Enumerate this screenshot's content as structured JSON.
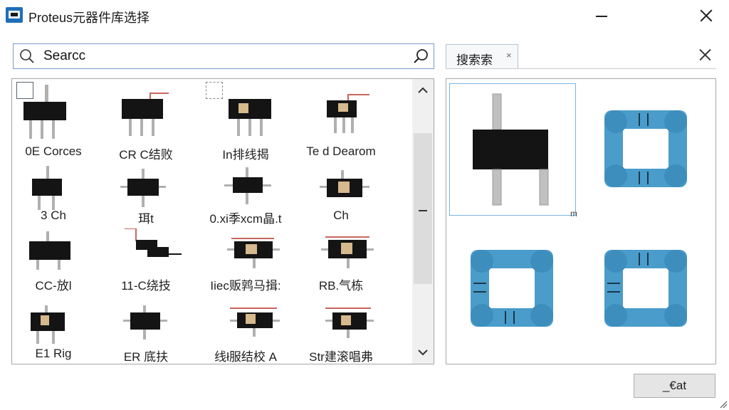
{
  "window": {
    "title": "Proteus元器件库选择"
  },
  "search": {
    "value": "Searcc"
  },
  "tab": {
    "label": "搜索索",
    "close": "×"
  },
  "grid": {
    "items": [
      {
        "label": "0E Corces"
      },
      {
        "label": "CR C结败"
      },
      {
        "label": "In排线揭"
      },
      {
        "label": "Te d Dearom"
      },
      {
        "label": "3 Ch"
      },
      {
        "label": "珥t"
      },
      {
        "label": "0.xi季xcm晶.t"
      },
      {
        "label": "Ch"
      },
      {
        "label": "CC-放l"
      },
      {
        "label": "11-C绕技"
      },
      {
        "label": "Iiec贩鹑马揖:"
      },
      {
        "label": "RB.气栋"
      },
      {
        "label": "E1 Rig"
      },
      {
        "label": "ER 底扶"
      },
      {
        "label": "线ł服结校 A"
      },
      {
        "label": "Str建滚唱弗"
      }
    ]
  },
  "preview": {
    "tag": "m"
  },
  "buttons": {
    "ok": "_€at"
  },
  "colors": {
    "accent": "#1e6fb8",
    "chip_body": "#141414",
    "pin": "#b0b0b0",
    "wire": "#c9665e",
    "label_tan": "#d6b98c",
    "footprint_blue": "#4a9ccb",
    "footprint_pad": "#3d8dbd"
  }
}
